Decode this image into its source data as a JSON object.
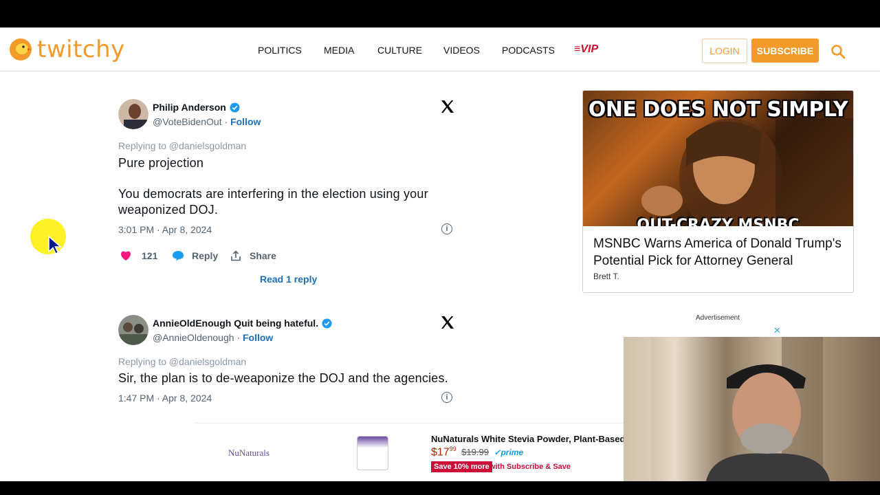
{
  "site": {
    "logo_text": "twitchy",
    "nav": [
      "POLITICS",
      "MEDIA",
      "CULTURE",
      "VIDEOS",
      "PODCASTS"
    ],
    "vip_label": "VIP",
    "login_label": "LOGIN",
    "subscribe_label": "SUBSCRIBE",
    "accent_color": "#f39a2b"
  },
  "tweets": [
    {
      "author": "Philip Anderson",
      "handle": "@VoteBidenOut",
      "follow_label": "Follow",
      "replying_to": "Replying to @danielsgoldman",
      "body_line1": "Pure projection",
      "body_line2": "You democrats are interfering in the election using your weaponized DOJ.",
      "timestamp": "3:01 PM · Apr 8, 2024",
      "likes": "121",
      "reply_label": "Reply",
      "share_label": "Share",
      "read_replies": "Read 1 reply"
    },
    {
      "author": "AnnieOldEnough Quit being hateful.",
      "handle": "@AnnieOldenough",
      "follow_label": "Follow",
      "replying_to": "Replying to @danielsgoldman",
      "body_line1": "Sir, the plan is to de-weaponize the DOJ and the agencies.",
      "timestamp": "1:47 PM · Apr 8, 2024"
    }
  ],
  "sidebar_card": {
    "meme_top": "ONE DOES NOT SIMPLY",
    "meme_bottom": "OUT-CRAZY MSNBC",
    "title": "MSNBC Warns America of Donald Trump's Potential Pick for Attorney General",
    "author": "Brett T."
  },
  "ad": {
    "label": "Advertisement",
    "close": "✕",
    "brand": "NuNaturals",
    "product_title": "NuNaturals White Stevia Powder, Plant-Based",
    "price_dollars": "$17",
    "price_cents": "99",
    "old_price": "$19.99",
    "prime": "✓prime",
    "save_badge": "Save 10% more",
    "subscribe_save": "with Subscribe & Save"
  }
}
